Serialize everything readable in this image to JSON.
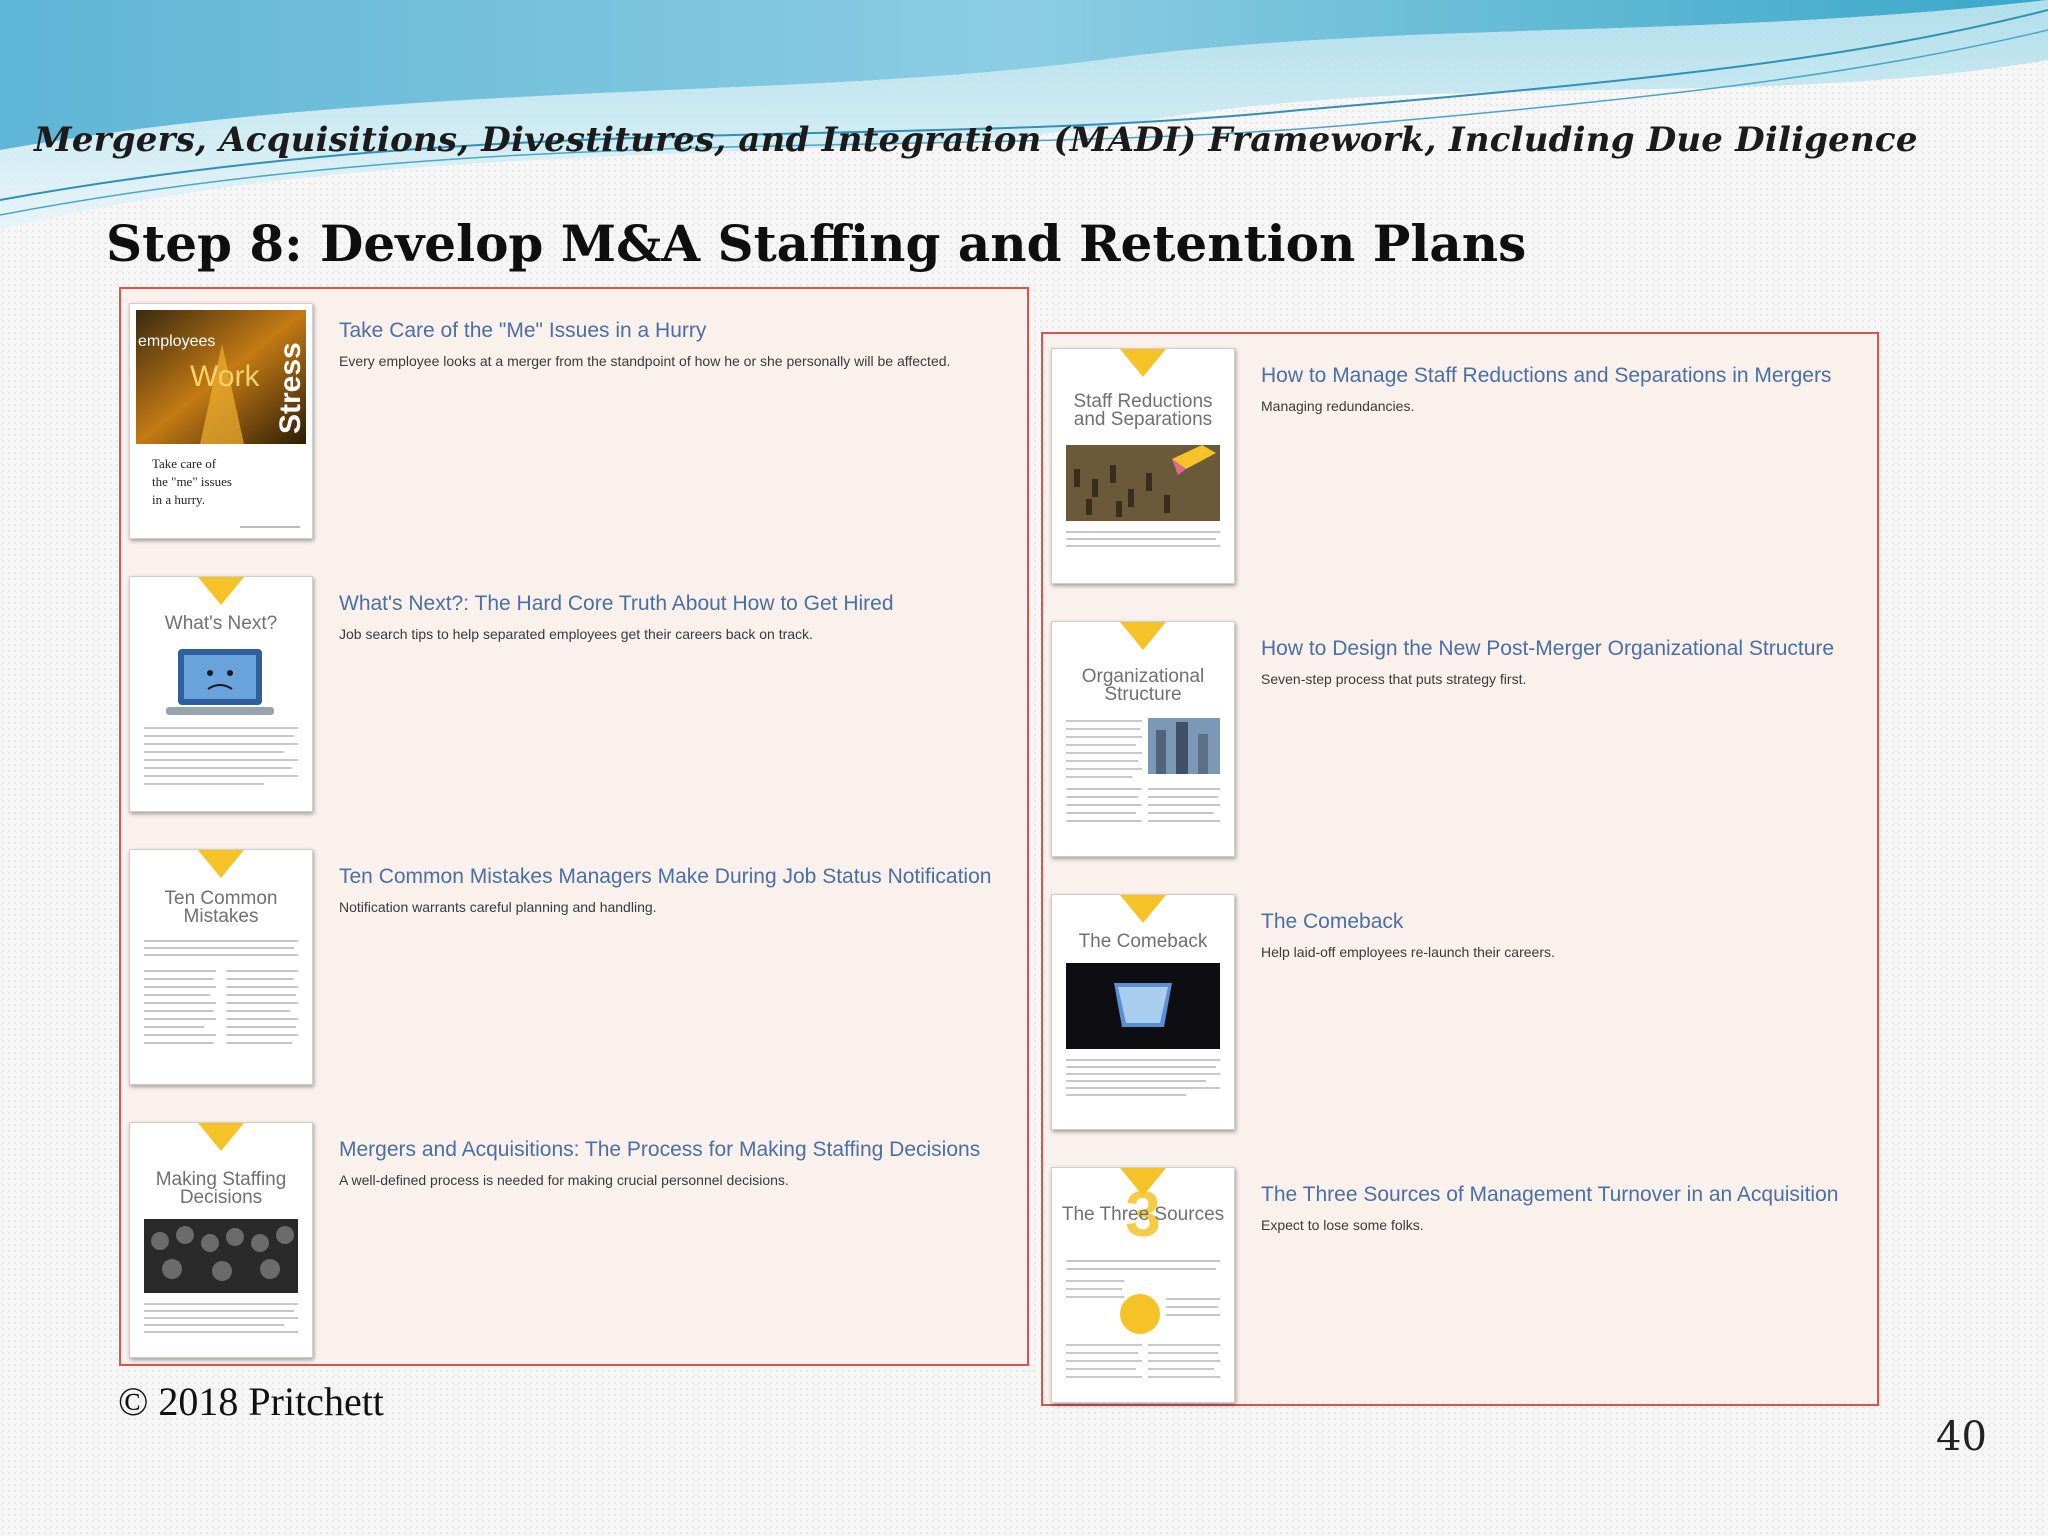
{
  "header": {
    "framework_title": "Mergers, Acquisitions, Divestitures, and Integration (MADI) Framework, Including Due Diligence",
    "step_title": "Step 8: Develop M&A Staffing and Retention Plans"
  },
  "left_column": [
    {
      "title": "Take Care of the \"Me\" Issues in a Hurry",
      "description": "Every employee looks at a merger from the standpoint of how he or she personally will be affected.",
      "cover_words": [
        "employees",
        "Work",
        "Stress"
      ],
      "cover_lines": [
        "Take care of",
        "the \"me\" issues",
        "in a hurry."
      ]
    },
    {
      "title": "What's Next?: The Hard Core Truth About How to Get Hired",
      "description": "Job search tips to help separated employees get their careers back on track.",
      "cover_title": "What's Next?"
    },
    {
      "title": "Ten Common Mistakes Managers Make During Job Status Notification",
      "description": "Notification warrants careful planning and handling.",
      "cover_title": "Ten Common Mistakes"
    },
    {
      "title": "Mergers and Acquisitions: The Process for Making Staffing Decisions",
      "description": "A well-defined process is needed for making crucial personnel decisions.",
      "cover_title": "Making Staffing Decisions"
    }
  ],
  "right_column": [
    {
      "title": "How to Manage Staff Reductions and Separations in Mergers",
      "description": "Managing redundancies.",
      "cover_title": "Staff Reductions and Separations"
    },
    {
      "title": "How to Design the New Post-Merger Organizational Structure",
      "description": "Seven-step process that puts strategy first.",
      "cover_title": "Organizational Structure"
    },
    {
      "title": "The Comeback",
      "description": "Help laid-off employees re-launch their careers.",
      "cover_title": "The Comeback"
    },
    {
      "title": "The Three Sources of Management Turnover in an Acquisition",
      "description": "Expect to lose some folks.",
      "cover_title": "The Three Sources"
    }
  ],
  "footer": {
    "copyright": "© 2018 Pritchett",
    "page_number": "40"
  },
  "colors": {
    "link_blue": "#4a6fa7",
    "panel_border": "#d9534f",
    "panel_bg": "#faf1ec",
    "accent_yellow": "#f5c328"
  }
}
